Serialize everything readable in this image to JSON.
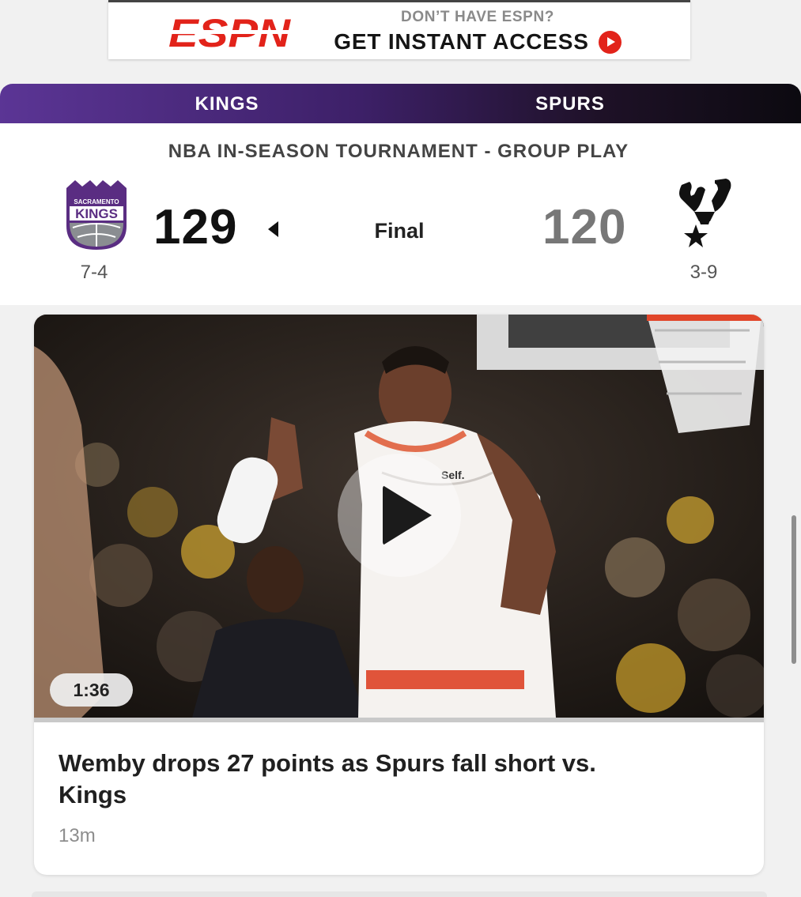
{
  "banner": {
    "logo": "ESPN",
    "subtitle": "DON’T HAVE ESPN?",
    "cta": "GET INSTANT ACCESS",
    "accent_color": "#e2231a",
    "icon": "play-circle-icon"
  },
  "game": {
    "header_gradient": [
      "#5b3595",
      "#0c0a10"
    ],
    "home": {
      "name": "KINGS",
      "score": "129",
      "record": "7-4",
      "logo_text_top": "SACRAMENTO",
      "logo_text_main": "KINGS",
      "logo_color": "#5a2d82"
    },
    "away": {
      "name": "SPURS",
      "score": "120",
      "record": "3-9",
      "logo_color": "#111111"
    },
    "event": "NBA IN-SEASON TOURNAMENT - GROUP PLAY",
    "status": "Final",
    "winner_indicator_icon": "caret-left-icon"
  },
  "video": {
    "duration": "1:36",
    "headline": "Wemby drops 27 points as Spurs fall short vs. Kings",
    "time_ago": "13m",
    "play_icon": "play-icon",
    "thumbnail_jersey_text": "Self."
  }
}
